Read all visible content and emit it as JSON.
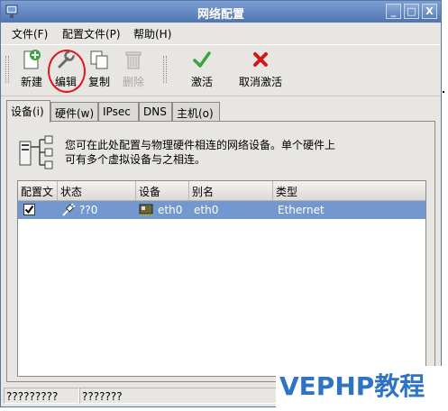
{
  "window": {
    "title": "网络配置"
  },
  "title_buttons": {
    "minimize": "_",
    "maximize": "□",
    "close": "X"
  },
  "menu": [
    "文件(F)",
    "配置文件(P)",
    "帮助(H)"
  ],
  "toolbar": {
    "new_label": "新建",
    "edit_label": "编辑",
    "copy_label": "复制",
    "delete_label": "删除",
    "activate_label": "激活",
    "deactivate_label": "取消激活"
  },
  "tabs": [
    "设备(i)",
    "硬件(w)",
    "IPsec",
    "DNS",
    "主机(o)"
  ],
  "info": {
    "line1": "您可在此处配置与物理硬件相连的网络设备。单个硬件上",
    "line2": "可有多个虚拟设备与之相连。"
  },
  "table": {
    "headers": [
      "配置文",
      "状态",
      "设备",
      "别名",
      "类型"
    ],
    "rows": [
      {
        "checked": true,
        "status": "??0",
        "device": "eth0",
        "alias": "eth0",
        "type": "Ethernet"
      }
    ]
  },
  "statusbar": {
    "left": "?????????",
    "right": "???????"
  },
  "watermark": "VEPHP教程",
  "colors": {
    "titlebar": "#4f74b2",
    "selection": "#7298cf",
    "watermark": "#2f74c4",
    "circle": "#e0141e"
  }
}
